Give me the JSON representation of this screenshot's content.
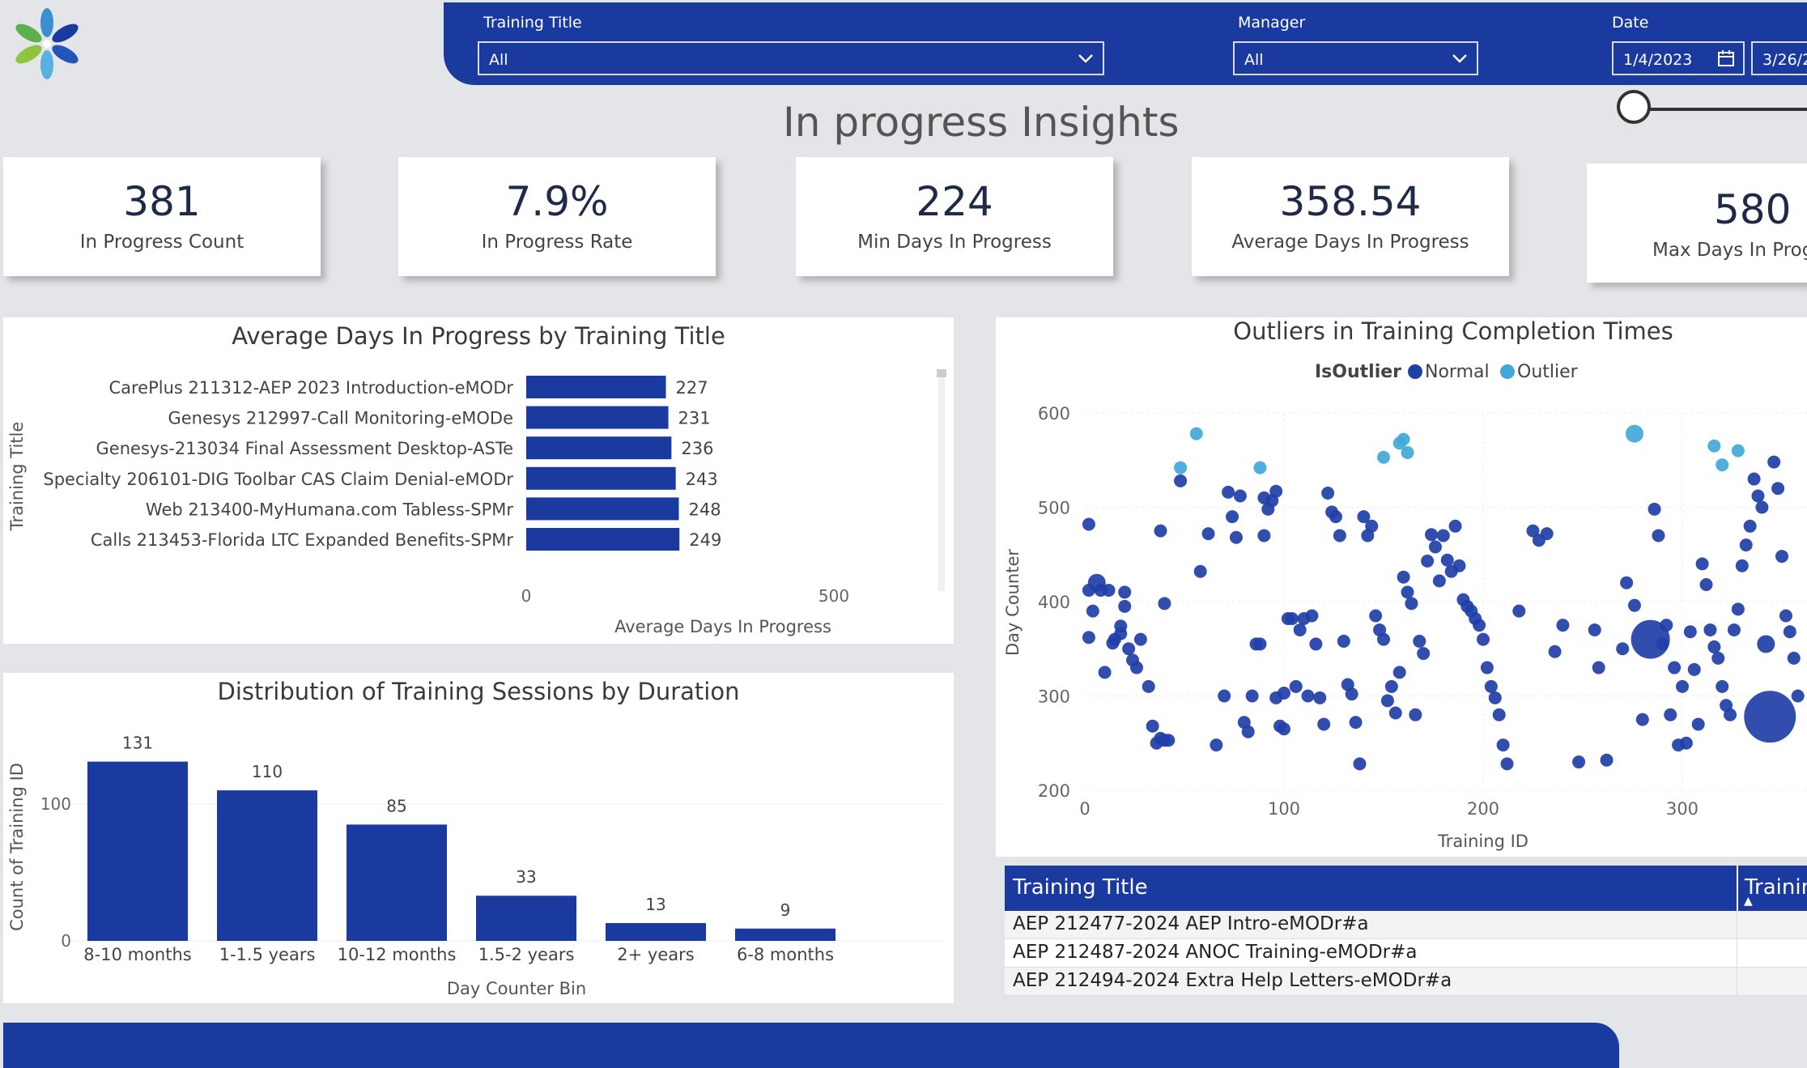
{
  "filters": {
    "training_title": {
      "label": "Training Title",
      "value": "All"
    },
    "manager": {
      "label": "Manager",
      "value": "All"
    },
    "date": {
      "label": "Date",
      "start": "1/4/2023",
      "end": "3/26/2"
    }
  },
  "page_title": "In progress Insights",
  "kpis": [
    {
      "value": "381",
      "label": "In Progress Count"
    },
    {
      "value": "7.9%",
      "label": "In Progress Rate"
    },
    {
      "value": "224",
      "label": "Min Days In Progress"
    },
    {
      "value": "358.54",
      "label": "Average Days In Progress"
    },
    {
      "value": "580",
      "label": "Max Days In Prog"
    }
  ],
  "colors": {
    "brand_blue": "#1a3aa0",
    "bar": "#1a3aa0",
    "normal": "#1f3fa8",
    "outlier": "#41a8d8"
  },
  "chart_data": [
    {
      "type": "bar",
      "orientation": "horizontal",
      "title": "Average Days In Progress by Training Title",
      "ylabel": "Training Title",
      "xlabel": "Average Days In Progress",
      "xlim": [
        0,
        600
      ],
      "xticks": [
        0,
        500
      ],
      "categories": [
        "CarePlus 211312-AEP 2023 Introduction-eMODr",
        "Genesys 212997-Call Monitoring-eMODe",
        "Genesys-213034 Final Assessment Desktop-ASTe",
        "Specialty 206101-DIG Toolbar CAS Claim Denial-eMODr",
        "Web 213400-MyHumana.com Tabless-SPMr",
        "Calls 213453-Florida LTC Expanded Benefits-SPMr"
      ],
      "values": [
        227,
        231,
        236,
        243,
        248,
        249
      ],
      "grid": false
    },
    {
      "type": "bar",
      "title": "Distribution of Training Sessions by Duration",
      "ylabel": "Count of Training ID",
      "xlabel": "Day Counter Bin",
      "ylim": [
        0,
        140
      ],
      "yticks": [
        0,
        100
      ],
      "categories": [
        "8-10 months",
        "1-1.5 years",
        "10-12 months",
        "1.5-2 years",
        "2+ years",
        "6-8 months"
      ],
      "values": [
        131,
        110,
        85,
        33,
        13,
        9
      ],
      "grid": true
    },
    {
      "type": "scatter",
      "title": "Outliers in Training Completion Times",
      "legend_title": "IsOutlier",
      "legend_position": "top-center",
      "xlabel": "Training ID",
      "ylabel": "Day Counter",
      "xlim": [
        0,
        360
      ],
      "ylim": [
        200,
        600
      ],
      "xticks": [
        0,
        100,
        200,
        300
      ],
      "yticks": [
        200,
        300,
        400,
        500,
        600
      ],
      "grid": true,
      "series": [
        {
          "name": "Normal",
          "points": [
            [
              2,
              482,
              1
            ],
            [
              2,
              412,
              1
            ],
            [
              2,
              362,
              1
            ],
            [
              4,
              390,
              1
            ],
            [
              6,
              420,
              2
            ],
            [
              8,
              412,
              1
            ],
            [
              10,
              325,
              1
            ],
            [
              12,
              412,
              1
            ],
            [
              14,
              356,
              1
            ],
            [
              15,
              360,
              1
            ],
            [
              18,
              366,
              1
            ],
            [
              18,
              374,
              1
            ],
            [
              20,
              395,
              1
            ],
            [
              20,
              410,
              1
            ],
            [
              22,
              350,
              1
            ],
            [
              24,
              338,
              1
            ],
            [
              26,
              330,
              1
            ],
            [
              28,
              360,
              1
            ],
            [
              32,
              310,
              1
            ],
            [
              34,
              268,
              1
            ],
            [
              36,
              250,
              1
            ],
            [
              38,
              255,
              1
            ],
            [
              40,
              253,
              1
            ],
            [
              42,
              253,
              1
            ],
            [
              38,
              475,
              1
            ],
            [
              40,
              398,
              1
            ],
            [
              48,
              528,
              1
            ],
            [
              58,
              432,
              1
            ],
            [
              62,
              472,
              1
            ],
            [
              66,
              248,
              1
            ],
            [
              70,
              300,
              1
            ],
            [
              72,
              516,
              1
            ],
            [
              74,
              490,
              1
            ],
            [
              76,
              468,
              1
            ],
            [
              78,
              512,
              1
            ],
            [
              80,
              272,
              1
            ],
            [
              82,
              262,
              1
            ],
            [
              84,
              300,
              1
            ],
            [
              86,
              355,
              1
            ],
            [
              88,
              355,
              1
            ],
            [
              90,
              470,
              1
            ],
            [
              90,
              510,
              1
            ],
            [
              92,
              498,
              1
            ],
            [
              94,
              507,
              1
            ],
            [
              96,
              517,
              1
            ],
            [
              96,
              298,
              1
            ],
            [
              98,
              268,
              1
            ],
            [
              100,
              265,
              1
            ],
            [
              100,
              303,
              1
            ],
            [
              102,
              382,
              1
            ],
            [
              104,
              382,
              1
            ],
            [
              106,
              310,
              1
            ],
            [
              108,
              370,
              1
            ],
            [
              110,
              382,
              1
            ],
            [
              112,
              300,
              1
            ],
            [
              114,
              385,
              1
            ],
            [
              116,
              355,
              1
            ],
            [
              118,
              298,
              1
            ],
            [
              120,
              270,
              1
            ],
            [
              122,
              515,
              1
            ],
            [
              124,
              495,
              1
            ],
            [
              126,
              490,
              1
            ],
            [
              128,
              470,
              1
            ],
            [
              130,
              358,
              1
            ],
            [
              132,
              312,
              1
            ],
            [
              134,
              302,
              1
            ],
            [
              136,
              272,
              1
            ],
            [
              138,
              228,
              1
            ],
            [
              140,
              490,
              1
            ],
            [
              142,
              470,
              1
            ],
            [
              144,
              480,
              1
            ],
            [
              146,
              385,
              1
            ],
            [
              148,
              370,
              1
            ],
            [
              150,
              360,
              1
            ],
            [
              152,
              295,
              1
            ],
            [
              154,
              310,
              1
            ],
            [
              156,
              282,
              1
            ],
            [
              158,
              325,
              1
            ],
            [
              160,
              426,
              1
            ],
            [
              162,
              410,
              1
            ],
            [
              164,
              398,
              1
            ],
            [
              166,
              280,
              1
            ],
            [
              168,
              358,
              1
            ],
            [
              170,
              345,
              1
            ],
            [
              172,
              443,
              1
            ],
            [
              174,
              471,
              1
            ],
            [
              176,
              458,
              1
            ],
            [
              178,
              422,
              1
            ],
            [
              180,
              470,
              1
            ],
            [
              182,
              444,
              1
            ],
            [
              184,
              432,
              1
            ],
            [
              186,
              480,
              1
            ],
            [
              188,
              438,
              1
            ],
            [
              190,
              402,
              1
            ],
            [
              192,
              395,
              1
            ],
            [
              194,
              390,
              1
            ],
            [
              196,
              382,
              1
            ],
            [
              198,
              375,
              1
            ],
            [
              200,
              360,
              1
            ],
            [
              202,
              330,
              1
            ],
            [
              204,
              310,
              1
            ],
            [
              206,
              298,
              1
            ],
            [
              208,
              280,
              1
            ],
            [
              210,
              248,
              1
            ],
            [
              212,
              228,
              1
            ],
            [
              218,
              390,
              1
            ],
            [
              225,
              475,
              1
            ],
            [
              228,
              465,
              1
            ],
            [
              232,
              472,
              1
            ],
            [
              236,
              347,
              1
            ],
            [
              240,
              375,
              1
            ],
            [
              248,
              230,
              1
            ],
            [
              256,
              370,
              1
            ],
            [
              258,
              330,
              1
            ],
            [
              262,
              232,
              1
            ],
            [
              270,
              350,
              1
            ],
            [
              272,
              420,
              1
            ],
            [
              276,
              396,
              1
            ],
            [
              280,
              275,
              1
            ],
            [
              284,
              360,
              3
            ],
            [
              286,
              498,
              1
            ],
            [
              288,
              470,
              1
            ],
            [
              290,
              355,
              1
            ],
            [
              292,
              375,
              1
            ],
            [
              294,
              280,
              1
            ],
            [
              296,
              330,
              1
            ],
            [
              298,
              248,
              1
            ],
            [
              300,
              310,
              1
            ],
            [
              302,
              250,
              1
            ],
            [
              304,
              368,
              1
            ],
            [
              306,
              328,
              1
            ],
            [
              308,
              270,
              1
            ],
            [
              310,
              440,
              1
            ],
            [
              312,
              418,
              1
            ],
            [
              314,
              370,
              1
            ],
            [
              316,
              352,
              1
            ],
            [
              318,
              340,
              1
            ],
            [
              320,
              310,
              1
            ],
            [
              322,
              290,
              1
            ],
            [
              324,
              280,
              1
            ],
            [
              326,
              370,
              1
            ],
            [
              328,
              392,
              1
            ],
            [
              330,
              438,
              1
            ],
            [
              332,
              460,
              1
            ],
            [
              334,
              480,
              1
            ],
            [
              336,
              530,
              1
            ],
            [
              338,
              512,
              1
            ],
            [
              340,
              500,
              1
            ],
            [
              342,
              355,
              2
            ],
            [
              344,
              278,
              5
            ],
            [
              346,
              548,
              1
            ],
            [
              348,
              520,
              1
            ],
            [
              350,
              448,
              1
            ],
            [
              352,
              385,
              1
            ],
            [
              354,
              368,
              1
            ],
            [
              356,
              340,
              1
            ],
            [
              358,
              300,
              1
            ]
          ]
        },
        {
          "name": "Outlier",
          "points": [
            [
              48,
              542,
              1
            ],
            [
              56,
              578,
              1
            ],
            [
              88,
              542,
              1
            ],
            [
              150,
              553,
              1
            ],
            [
              158,
              568,
              1
            ],
            [
              160,
              572,
              1
            ],
            [
              162,
              558,
              1
            ],
            [
              276,
              578,
              2
            ],
            [
              316,
              565,
              1
            ],
            [
              320,
              545,
              1
            ],
            [
              328,
              560,
              1
            ]
          ]
        }
      ]
    }
  ],
  "table": {
    "columns": [
      "Training Title",
      "Trainin"
    ],
    "sort_indicator": "▲",
    "rows": [
      "AEP 212477-2024 AEP Intro-eMODr#a",
      "AEP 212487-2024 ANOC Training-eMODr#a",
      "AEP 212494-2024 Extra Help Letters-eMODr#a"
    ]
  }
}
